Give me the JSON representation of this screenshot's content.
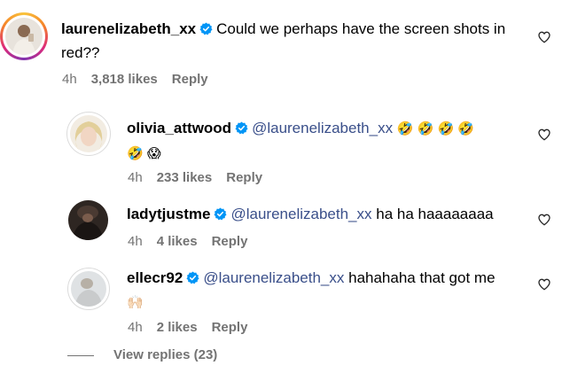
{
  "comments": [
    {
      "username": "laurenelizabeth_xx",
      "verified": true,
      "text": "Could we perhaps have the screen shots in red??",
      "time": "4h",
      "likes": "3,818 likes",
      "reply": "Reply"
    },
    {
      "username": "olivia_attwood",
      "verified": true,
      "mention": "@laurenelizabeth_xx",
      "emoji_line1": "🤣 🤣 🤣 🤣",
      "emoji_line2": "🤣 😱",
      "time": "4h",
      "likes": "233 likes",
      "reply": "Reply"
    },
    {
      "username": "ladytjustme",
      "verified": true,
      "mention": "@laurenelizabeth_xx",
      "text": "ha ha haaaaaaaa",
      "time": "4h",
      "likes": "4 likes",
      "reply": "Reply"
    },
    {
      "username": "ellecr92",
      "verified": true,
      "mention": "@laurenelizabeth_xx",
      "text": "hahahaha that got me",
      "emoji_line2": "🙌🏻",
      "time": "4h",
      "likes": "2 likes",
      "reply": "Reply"
    }
  ],
  "view_replies": "View replies (23)",
  "icons": {
    "verified": "verified-badge-icon",
    "like": "heart-outline-icon"
  },
  "colors": {
    "verified_blue": "#0095f6",
    "mention": "#3a4f8a",
    "meta_gray": "#737373"
  }
}
